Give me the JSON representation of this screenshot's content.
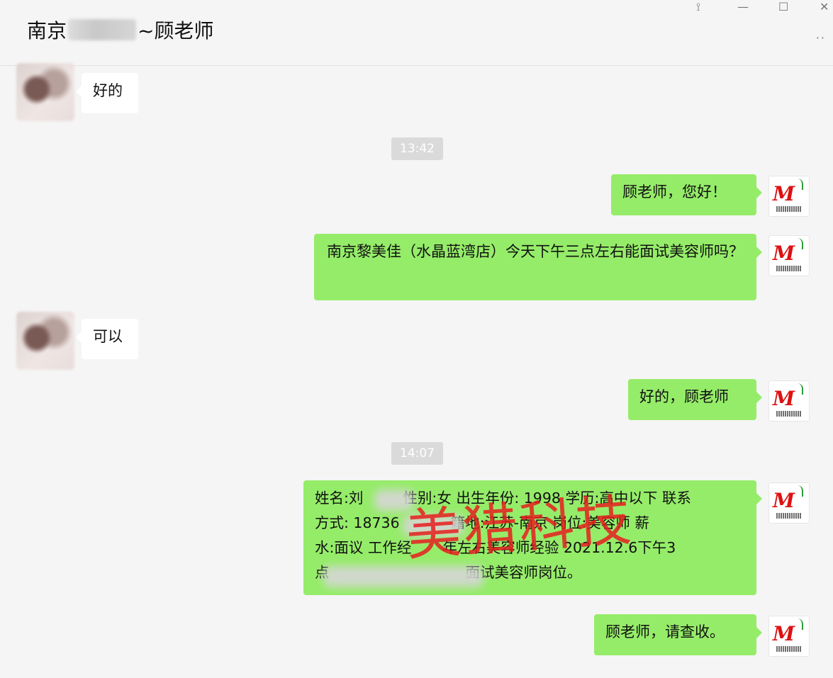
{
  "header": {
    "title_prefix": "南京",
    "title_suffix": "~顾老师",
    "more_label": "··"
  },
  "window": {
    "pin": "⟟",
    "minimize": "—",
    "maximize": "☐",
    "close": "✕"
  },
  "messages": {
    "m1": "好的",
    "t1": "13:42",
    "m2": "顾老师，您好！",
    "m3": " 南京黎美佳（水晶蓝湾店）今天下午三点左右能面试美容师吗？",
    "m4": "可以",
    "m5": "好的，顾老师",
    "t2": "14:07",
    "m6_l1": "姓名:刘",
    "m6_l1b": "性别:女 出生年份: 1998 学历:高中以下 联系",
    "m6_l2": "方式: 18736",
    "m6_l2b": "籍地:江苏-南京 岗位:美容师 薪",
    "m6_l3": "水:面议 工作经",
    "m6_l3b": "年左右美容师经验 2021.12.6下午3",
    "m6_l4": "点",
    "m6_l4b": "面试美容师岗位。",
    "m7": "顾老师，请查收。"
  },
  "watermark": "美猎科技",
  "colors": {
    "outgoing_bubble": "#95ec69",
    "incoming_bubble": "#ffffff",
    "background": "#f5f5f5",
    "timestamp_bg": "#dadada",
    "watermark": "#e61e1e"
  }
}
